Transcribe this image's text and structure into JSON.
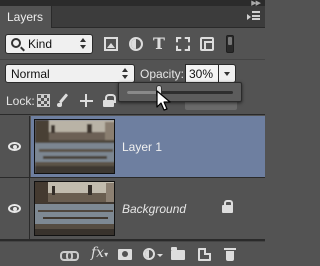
{
  "panel": {
    "tab_label": "Layers",
    "collapse_glyph": "▶▶",
    "menu_icon": "panel-menu-icon"
  },
  "filter": {
    "kind_label": "Kind",
    "icons": [
      "image-filter-icon",
      "adjustment-filter-icon",
      "type-filter-icon",
      "shape-filter-icon",
      "smart-object-filter-icon",
      "filter-toggle-icon"
    ],
    "type_glyph": "T"
  },
  "blend": {
    "mode": "Normal",
    "opacity_label": "Opacity:",
    "opacity_value": "30%",
    "opacity_slider_level": 0.3
  },
  "lock": {
    "label": "Lock:",
    "icons": [
      "lock-transparent-icon",
      "lock-image-icon",
      "lock-position-icon",
      "lock-all-icon"
    ]
  },
  "layers": [
    {
      "name": "Layer 1",
      "selected": true,
      "visible": true,
      "locked": false,
      "thumbnail": "city-bridges-blurred"
    },
    {
      "name": "Background",
      "selected": false,
      "visible": true,
      "locked": true,
      "thumbnail": "city-bridges"
    }
  ],
  "footer": {
    "fx_label": "fx",
    "icons": [
      "link-layers-icon",
      "fx-icon",
      "layer-mask-icon",
      "adjustment-layer-icon",
      "group-folder-icon",
      "new-layer-icon",
      "trash-icon"
    ]
  },
  "colors": {
    "panel_bg": "#535353",
    "selected_row": "#6e7fa0",
    "field_bg": "#f0f0f0"
  }
}
